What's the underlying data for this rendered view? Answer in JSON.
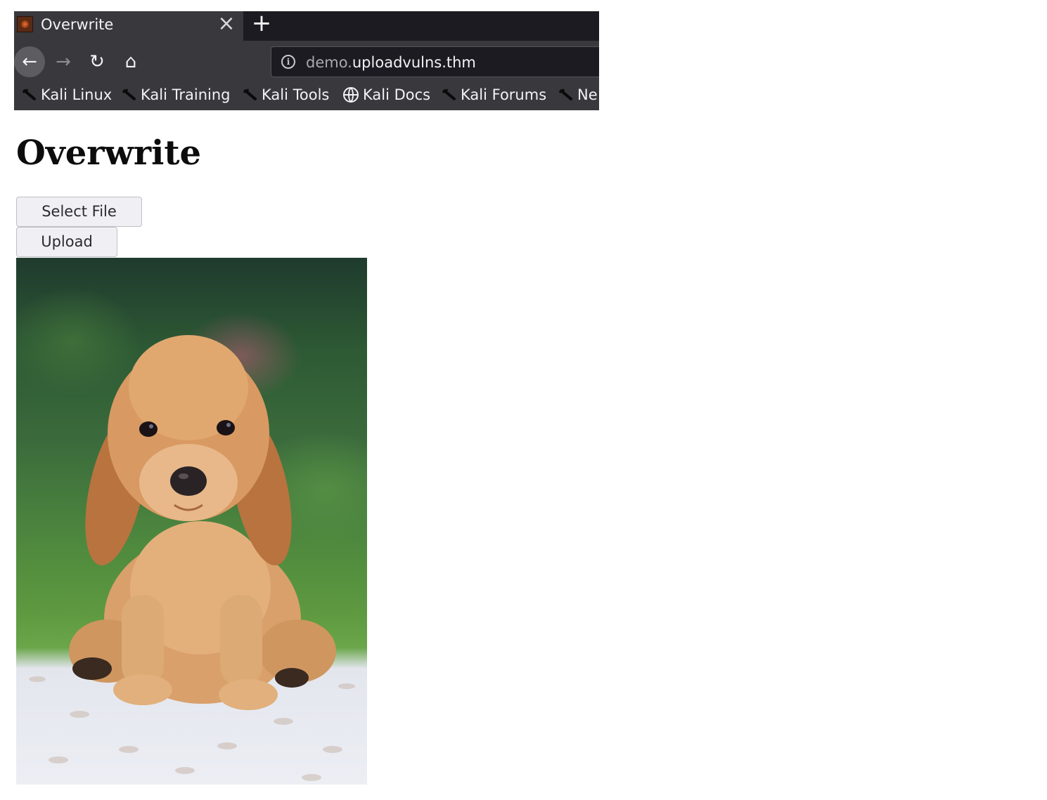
{
  "browser": {
    "tab_title": "Overwrite",
    "tab_close": "×",
    "new_tab": "+",
    "url_subdomain": "demo.",
    "url_host": "uploadvulns.thm",
    "nav": {
      "back": "←",
      "forward": "→",
      "reload": "↻",
      "home": "⌂",
      "info": "i"
    },
    "bookmarks": [
      {
        "label": "Kali Linux",
        "icon": "kali-dragon-icon"
      },
      {
        "label": "Kali Training",
        "icon": "kali-dragon-icon"
      },
      {
        "label": "Kali Tools",
        "icon": "kali-dragon-icon"
      },
      {
        "label": "Kali Docs",
        "icon": "globe-icon"
      },
      {
        "label": "Kali Forums",
        "icon": "kali-dragon-icon"
      },
      {
        "label": "Ne",
        "icon": "kali-dragon-icon"
      }
    ]
  },
  "page": {
    "heading": "Overwrite",
    "select_file_label": "Select File",
    "upload_label": "Upload",
    "image_subject": "cocker spaniel puppy photo"
  },
  "colors": {
    "chrome_dark": "#1c1b22",
    "chrome": "#38383d",
    "text_light": "#f3f3f5",
    "button_bg": "#f0f0f4"
  }
}
